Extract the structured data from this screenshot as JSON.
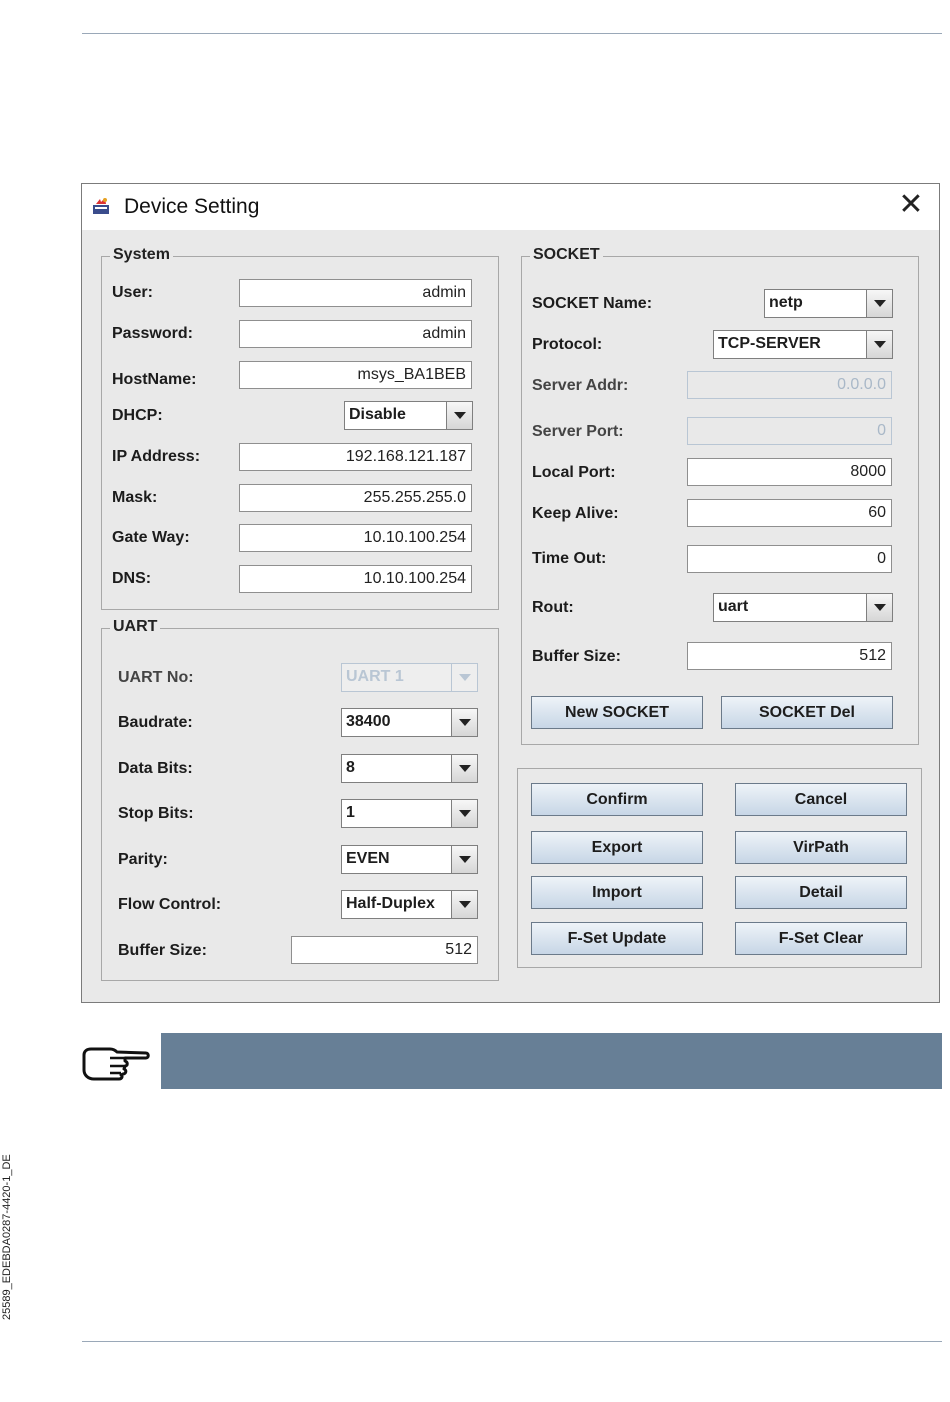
{
  "window": {
    "title": "Device Setting",
    "icon": "app-icon",
    "close": "close-icon"
  },
  "system": {
    "title": "System",
    "user_label": "User:",
    "user_value": "admin",
    "password_label": "Password:",
    "password_value": "admin",
    "hostname_label": "HostName:",
    "hostname_value": "msys_BA1BEB",
    "dhcp_label": "DHCP:",
    "dhcp_value": "Disable",
    "ip_label": "IP Address:",
    "ip_value": "192.168.121.187",
    "mask_label": "Mask:",
    "mask_value": "255.255.255.0",
    "gateway_label": "Gate Way:",
    "gateway_value": "10.10.100.254",
    "dns_label": "DNS:",
    "dns_value": "10.10.100.254"
  },
  "uart": {
    "title": "UART",
    "no_label": "UART No:",
    "no_value": "UART 1",
    "baud_label": "Baudrate:",
    "baud_value": "38400",
    "databits_label": "Data Bits:",
    "databits_value": "8",
    "stopbits_label": "Stop Bits:",
    "stopbits_value": "1",
    "parity_label": "Parity:",
    "parity_value": "EVEN",
    "flow_label": "Flow Control:",
    "flow_value": "Half-Duplex",
    "buffer_label": "Buffer Size:",
    "buffer_value": "512"
  },
  "socket": {
    "title": "SOCKET",
    "name_label": "SOCKET Name:",
    "name_value": "netp",
    "protocol_label": "Protocol:",
    "protocol_value": "TCP-SERVER",
    "server_addr_label": "Server Addr:",
    "server_addr_value": "0.0.0.0",
    "server_port_label": "Server Port:",
    "server_port_value": "0",
    "local_port_label": "Local Port:",
    "local_port_value": "8000",
    "keep_alive_label": "Keep Alive:",
    "keep_alive_value": "60",
    "timeout_label": "Time Out:",
    "timeout_value": "0",
    "rout_label": "Rout:",
    "rout_value": "uart",
    "buffer_label": "Buffer Size:",
    "buffer_value": "512",
    "new_button": "New SOCKET",
    "del_button": "SOCKET Del"
  },
  "actions": {
    "confirm": "Confirm",
    "cancel": "Cancel",
    "export": "Export",
    "virpath": "VirPath",
    "import": "Import",
    "detail": "Detail",
    "fset_update": "F-Set Update",
    "fset_clear": "F-Set Clear"
  },
  "note": {
    "icon": "pointing-hand-icon",
    "bar_color": "#677f96"
  },
  "side_code": "25589_EDEBDA0287-4420-1_DE"
}
